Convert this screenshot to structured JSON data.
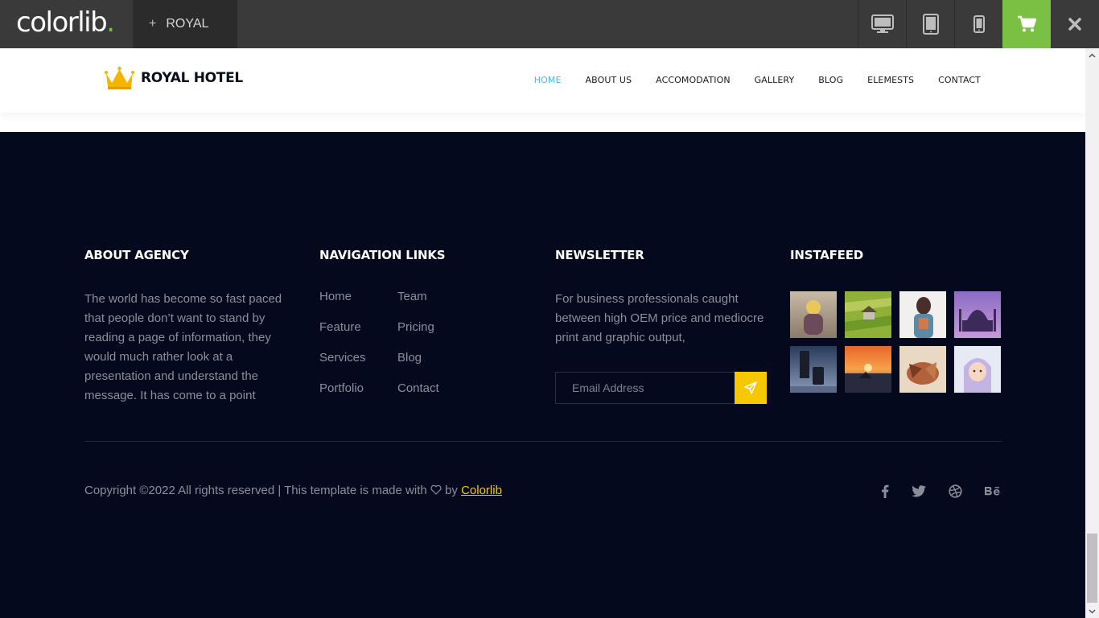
{
  "browser": {
    "brand": "colorlib",
    "brand_dot": ".",
    "theme_tab": "ROYAL",
    "accent_color": "#7ac143",
    "device_buttons": [
      "desktop-icon",
      "tablet-icon",
      "mobile-icon"
    ],
    "cart_icon": "cart-icon",
    "close_icon": "close-icon"
  },
  "header": {
    "logo_text": "ROYAL HOTEL",
    "logo_icon": "crown-icon",
    "nav": [
      {
        "label": "HOME",
        "active": true
      },
      {
        "label": "ABOUT US",
        "active": false
      },
      {
        "label": "ACCOMODATION",
        "active": false
      },
      {
        "label": "GALLERY",
        "active": false
      },
      {
        "label": "BLOG",
        "active": false
      },
      {
        "label": "ELEMESTS",
        "active": false
      },
      {
        "label": "CONTACT",
        "active": false
      }
    ],
    "active_color": "#4bb8e5"
  },
  "footer": {
    "background": "#04091e",
    "about": {
      "title": "ABOUT AGENCY",
      "text": "The world has become so fast paced that people don’t want to stand by reading a page of information, they would much rather look at a presentation and understand the message. It has come to a point"
    },
    "navigation": {
      "title": "NAVIGATION LINKS",
      "links": [
        "Home",
        "Team",
        "Feature",
        "Pricing",
        "Services",
        "Blog",
        "Portfolio",
        "Contact"
      ]
    },
    "newsletter": {
      "title": "NEWSLETTER",
      "text": "For business professionals caught between high OEM price and mediocre print and graphic output,",
      "placeholder": "Email Address",
      "button_icon": "send-icon",
      "button_color": "#f7c700"
    },
    "instafeed": {
      "title": "INSTAFEED",
      "photos": [
        "photo-child-backpack",
        "photo-rice-hut",
        "photo-girl-backpack",
        "photo-taj-mahal",
        "photo-traveler-suitcase",
        "photo-sunset-boat",
        "photo-hands-leaves",
        "photo-child-hood"
      ]
    },
    "copyright": {
      "before": "Copyright ©2022 All rights reserved | This template is made with",
      "by": "by",
      "link": "Colorlib",
      "heart_icon": "heart-icon"
    },
    "social_icons": [
      "facebook-icon",
      "twitter-icon",
      "dribbble-icon",
      "behance-icon"
    ]
  }
}
